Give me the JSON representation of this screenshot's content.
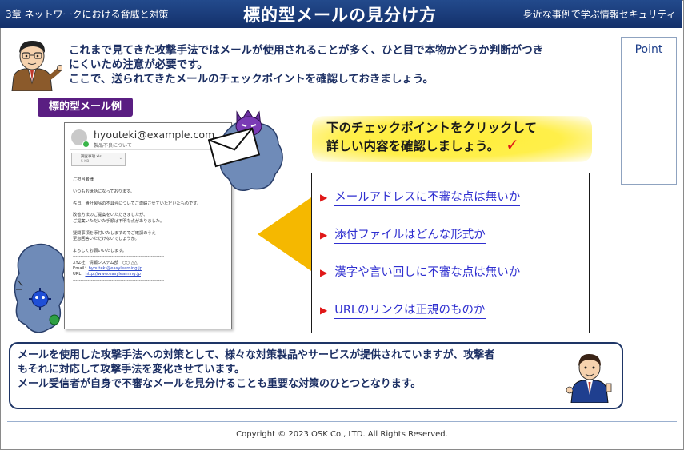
{
  "header": {
    "chapter": "3章 ネットワークにおける脅威と対策",
    "title": "標的型メールの見分け方",
    "course": "身近な事例で学ぶ情報セキュリティ"
  },
  "point_panel": {
    "label": "Point"
  },
  "intro": {
    "lines": [
      "これまで見てきた攻撃手法ではメールが使用されることが多く、ひと目で本物かどうか判断がつき",
      "にくいため注意が必要です。",
      "ここで、送られてきたメールのチェックポイントを確認しておきましょう。"
    ]
  },
  "example_tag": "標的型メール例",
  "mail": {
    "from": "hyouteki@example.com",
    "subject": "製品不良について",
    "attachment_name": "調査事項.xlsl",
    "attachment_size": "5 KB",
    "body": [
      "ご担当者様",
      "",
      "いつもお世話になっております。",
      "",
      "先日、貴社製品の不具合についてご連絡させていただいたものです。",
      "",
      "改善方法のご提案をいただきましたが、",
      "ご提案いただいた手順は不明な点がありました。",
      "",
      "疑問事項を添付いたしますのでご確認のうえ",
      "至急回答いただけないでしょうか。",
      "",
      "よろしくお願いいたします。",
      "-------------------------------------------------------------",
      "XYZ社　情報システム部　○○ △△"
    ],
    "email_label": "Email：",
    "email_value": "hyouteki@easylearning.jp",
    "url_label": "URL：",
    "url_value": "http://www.easylearning.jp",
    "closing_rule": "-------------------------------------------------------------"
  },
  "instruction": {
    "text_line1": "下のチェックポイントをクリックして",
    "text_line2": "詳しい内容を確認しましょう。",
    "check_mark": "✓"
  },
  "checkpoints": [
    {
      "bullet": "▶",
      "label": "メールアドレスに不審な点は無いか"
    },
    {
      "bullet": "▶",
      "label": "添付ファイルはどんな形式か"
    },
    {
      "bullet": "▶",
      "label": "漢字や言い回しに不審な点は無いか"
    },
    {
      "bullet": "▶",
      "label": "URLのリンクは正規のものか"
    }
  ],
  "note": {
    "lines": [
      "メールを使用した攻撃手法への対策として、様々な対策製品やサービスが提供されていますが、攻撃者",
      "もそれに対応して攻撃手法を変化させています。",
      "メール受信者が自身で不審なメールを見分けることも重要な対策のひとつとなります。"
    ]
  },
  "footer": {
    "copyright": "Copyright © 2023 OSK Co., LTD. All Rights Reserved."
  },
  "colors": {
    "header_bg": "#1b3d7e",
    "tag_bg": "#5a1e82",
    "link_blue": "#2f2fd0",
    "bullet_red": "#e01818",
    "highlight_yellow": "#ffee3a",
    "pointer_yellow": "#f5b800",
    "text_navy": "#1c2f63"
  }
}
